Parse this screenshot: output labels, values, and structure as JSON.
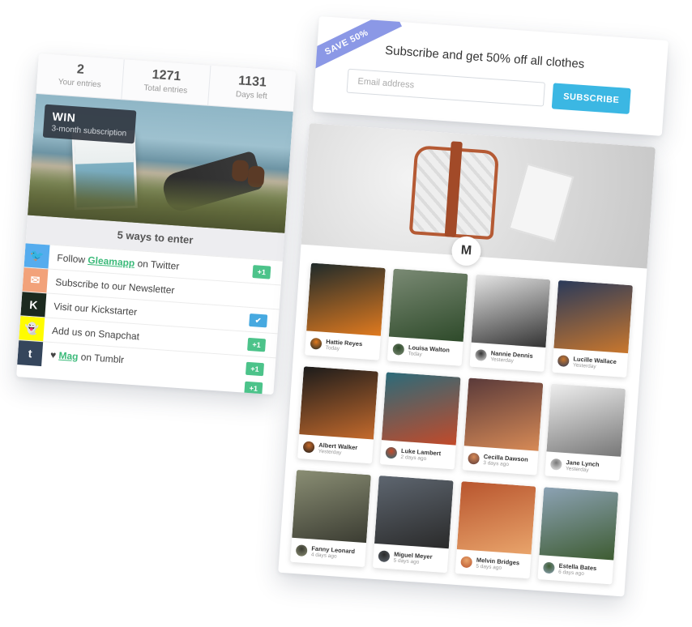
{
  "competition": {
    "stats": [
      {
        "value": "2",
        "label": "Your entries"
      },
      {
        "value": "1271",
        "label": "Total entries"
      },
      {
        "value": "1131",
        "label": "Days left"
      }
    ],
    "prize": {
      "title": "WIN",
      "subtitle": "3-month subscription"
    },
    "ways_heading": "5 ways to enter",
    "entries": [
      {
        "icon": "twitter-icon",
        "color": "#55acee",
        "pre": "Follow ",
        "link": "Gleamapp",
        "post": " on Twitter",
        "badge": "+1",
        "done": false
      },
      {
        "icon": "envelope-icon",
        "color": "#f2a27a",
        "pre": "Subscribe to our Newsletter",
        "link": "",
        "post": "",
        "badge": "",
        "done": false
      },
      {
        "icon": "kickstarter-icon",
        "color": "#1c2a1f",
        "pre": "Visit our Kickstarter",
        "link": "",
        "post": "",
        "badge": "✔",
        "done": true
      },
      {
        "icon": "snapchat-icon",
        "color": "#fffc00",
        "pre": "Add us on Snapchat",
        "link": "",
        "post": "",
        "badge": "+1",
        "done": false
      },
      {
        "icon": "tumblr-icon",
        "color": "#35465c",
        "pre": "♥ ",
        "link": "Mag",
        "post": " on Tumblr",
        "badge": "+1",
        "done": false
      }
    ],
    "extra_badges": [
      "+1",
      "+1"
    ]
  },
  "newsletter": {
    "ribbon": "SAVE 50%",
    "title": "Subscribe and get 50% off all clothes",
    "email_placeholder": "Email address",
    "button": "SUBSCRIBE"
  },
  "gallery": {
    "brand_letter": "M",
    "photos": [
      {
        "name": "Hattie Reyes",
        "time": "Today",
        "colors": [
          "#1f2a2a",
          "#e07a1f"
        ]
      },
      {
        "name": "Louisa Walton",
        "time": "Today",
        "colors": [
          "#7a8a74",
          "#2e4a2a"
        ]
      },
      {
        "name": "Nannie Dennis",
        "time": "Yesterday",
        "colors": [
          "#e5e5e5",
          "#333333"
        ]
      },
      {
        "name": "Lucille Wallace",
        "time": "Yesterday",
        "colors": [
          "#2a3a5a",
          "#c9772d"
        ]
      },
      {
        "name": "Albert Walker",
        "time": "Yesterday",
        "colors": [
          "#1b1b1b",
          "#c46a2c"
        ]
      },
      {
        "name": "Luke Lambert",
        "time": "2 days ago",
        "colors": [
          "#2b6b7a",
          "#c24a2a"
        ]
      },
      {
        "name": "Cecilla Dawson",
        "time": "3 days ago",
        "colors": [
          "#5a3a3a",
          "#d78a56"
        ]
      },
      {
        "name": "Jane Lynch",
        "time": "Yesterday",
        "colors": [
          "#eeeeee",
          "#777777"
        ]
      },
      {
        "name": "Fanny Leonard",
        "time": "4 days ago",
        "colors": [
          "#8a8e74",
          "#3b3c32"
        ]
      },
      {
        "name": "Miguel Meyer",
        "time": "5 days ago",
        "colors": [
          "#5e6670",
          "#2a2a2a"
        ]
      },
      {
        "name": "Melvin Bridges",
        "time": "5 days ago",
        "colors": [
          "#b8552e",
          "#e9a46b"
        ]
      },
      {
        "name": "Estella Bates",
        "time": "6 days ago",
        "colors": [
          "#8ca2b4",
          "#3e5c32"
        ]
      }
    ]
  }
}
